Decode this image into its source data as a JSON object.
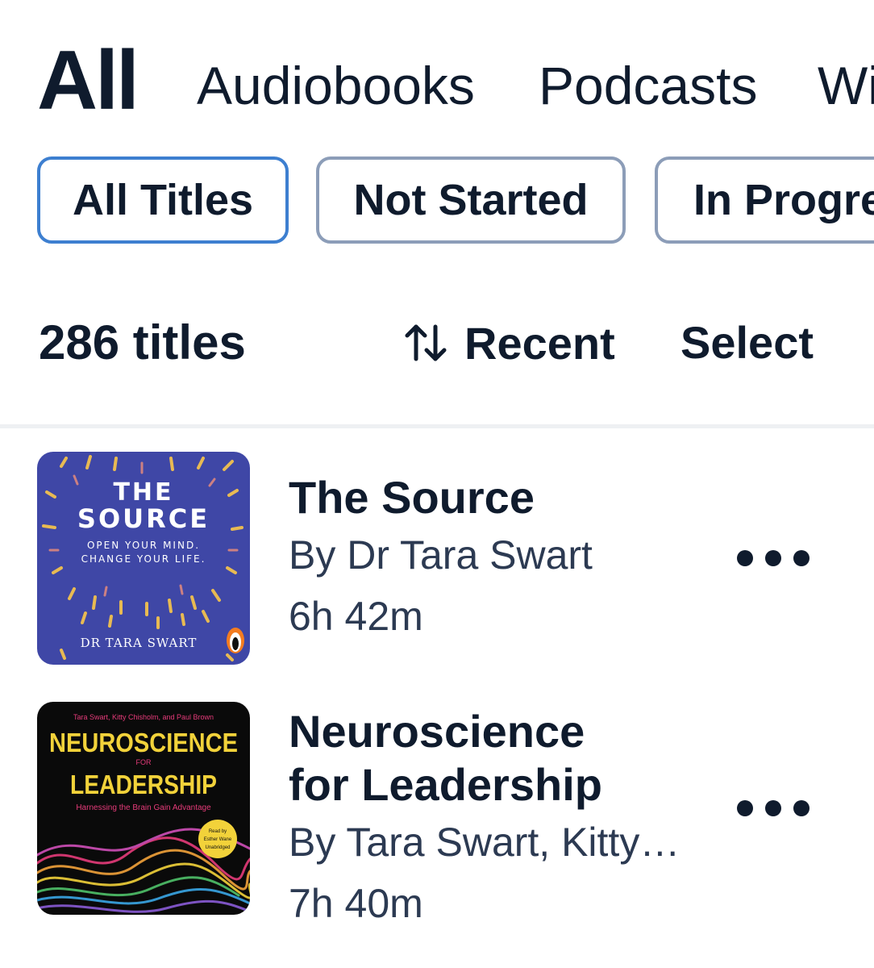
{
  "tabs": {
    "all": "All",
    "audiobooks": "Audiobooks",
    "podcasts": "Podcasts",
    "wishlist": "Wi"
  },
  "filters": {
    "all_titles": "All Titles",
    "not_started": "Not Started",
    "in_progress": "In Progre"
  },
  "toolbar": {
    "count": "286 titles",
    "sort_icon": "sort-arrows-icon",
    "sort_label": "Recent",
    "select_label": "Select"
  },
  "items": [
    {
      "title": "The Source",
      "author": "By Dr Tara Swart",
      "duration": "6h 42m",
      "cover": {
        "line1": "THE",
        "line2": "SOURCE",
        "tagline1": "OPEN YOUR MIND.",
        "tagline2": "CHANGE YOUR LIFE.",
        "author": "DR TARA SWART",
        "bg": "#3f47a6",
        "accent": "#f2c14e"
      }
    },
    {
      "title_line1": "Neuroscience",
      "title_line2": "for Leadership",
      "author": "By Tara Swart, Kitty…",
      "duration": "7h 40m",
      "cover": {
        "authors": "Tara Swart, Kitty Chisholm, and Paul Brown",
        "line1": "NEUROSCIENCE",
        "for": "FOR",
        "line2": "LEADERSHIP",
        "subtitle": "Harnessing the Brain Gain Advantage",
        "badge1": "Read by",
        "badge2": "Esther Wane",
        "badge3": "Unabridged",
        "bg": "#0a0a0a",
        "accent": "#f2d23a"
      }
    }
  ],
  "colors": {
    "text": "#0f1b2d",
    "secondary": "#2c3a52",
    "chip_border": "#8c9db8",
    "chip_active_border": "#3d7fd0"
  }
}
